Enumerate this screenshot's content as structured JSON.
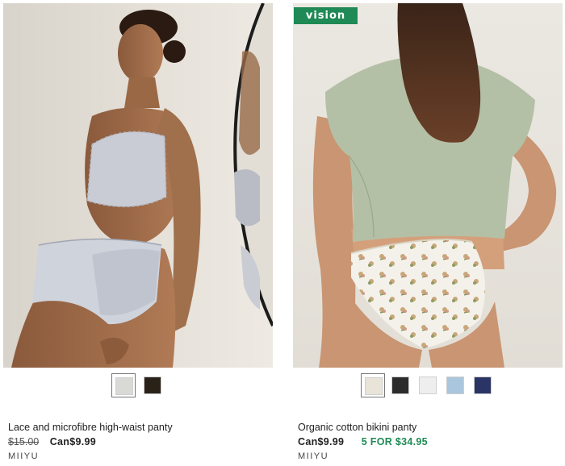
{
  "products": [
    {
      "name": "Lace and microfibre high-waist panty",
      "old_price": "$15.00",
      "price": "Can$9.99",
      "brand": "MIIYU",
      "swatches": [
        {
          "color": "#d9d9d6",
          "selected": true
        },
        {
          "color": "#2a2119",
          "selected": false
        }
      ]
    },
    {
      "badge": "vision",
      "name": "Organic cotton bikini panty",
      "price": "Can$9.99",
      "promo": "5 FOR $34.95",
      "brand": "MIIYU",
      "swatches": [
        {
          "color": "#e8e4d8",
          "selected": true
        },
        {
          "color": "#2c2c2c",
          "selected": false
        },
        {
          "color": "#eeeeee",
          "selected": false
        },
        {
          "color": "#a9c6dc",
          "selected": false
        },
        {
          "color": "#2a3566",
          "selected": false
        }
      ]
    }
  ]
}
